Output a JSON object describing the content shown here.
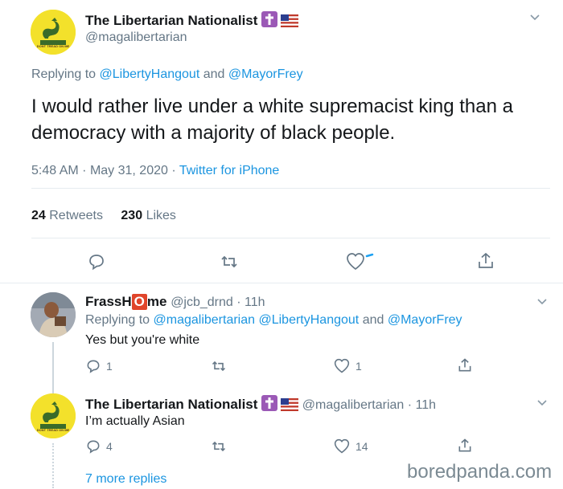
{
  "main_tweet": {
    "author_name": "The Libertarian Nationalist",
    "author_handle": "@magalibertarian",
    "avatar_text": "DONT TREAD ON ME",
    "replying_prefix": "Replying to",
    "replying_to_1": "@LibertyHangout",
    "replying_and": "and",
    "replying_to_2": "@MayorFrey",
    "text": "I would rather live under a white supremacist king than a democracy with a majority of black people.",
    "time": "5:48 AM",
    "sep": "·",
    "date": "May 31, 2020",
    "source": "Twitter for iPhone",
    "retweets_count": "24",
    "retweets_label": "Retweets",
    "likes_count": "230",
    "likes_label": "Likes"
  },
  "reply1": {
    "author_name_part1": "FrassH",
    "author_name_box": "O",
    "author_name_part2": "me",
    "author_handle": "@jcb_drnd",
    "sep": "·",
    "time": "11h",
    "replying_prefix": "Replying to",
    "replying_to_1": "@magalibertarian",
    "replying_to_2": "@LibertyHangout",
    "replying_and": "and",
    "replying_to_3": "@MayorFrey",
    "text": "Yes but you're white",
    "reply_count": "1",
    "like_count": "1"
  },
  "reply2": {
    "author_name": "The Libertarian Nationalist",
    "author_handle": "@magalibertarian",
    "sep": "·",
    "time": "11h",
    "avatar_text": "DONT TREAD ON ME",
    "text": "I’m actually Asian",
    "reply_count": "4",
    "like_count": "14"
  },
  "more_replies": "7 more replies",
  "watermark": "boredpanda.com",
  "colors": {
    "link": "#1b95e0",
    "muted": "#657786",
    "gadsden_yellow": "#f3e12b",
    "cross_purple": "#9b59b6",
    "name_box_red": "#e0452b"
  }
}
